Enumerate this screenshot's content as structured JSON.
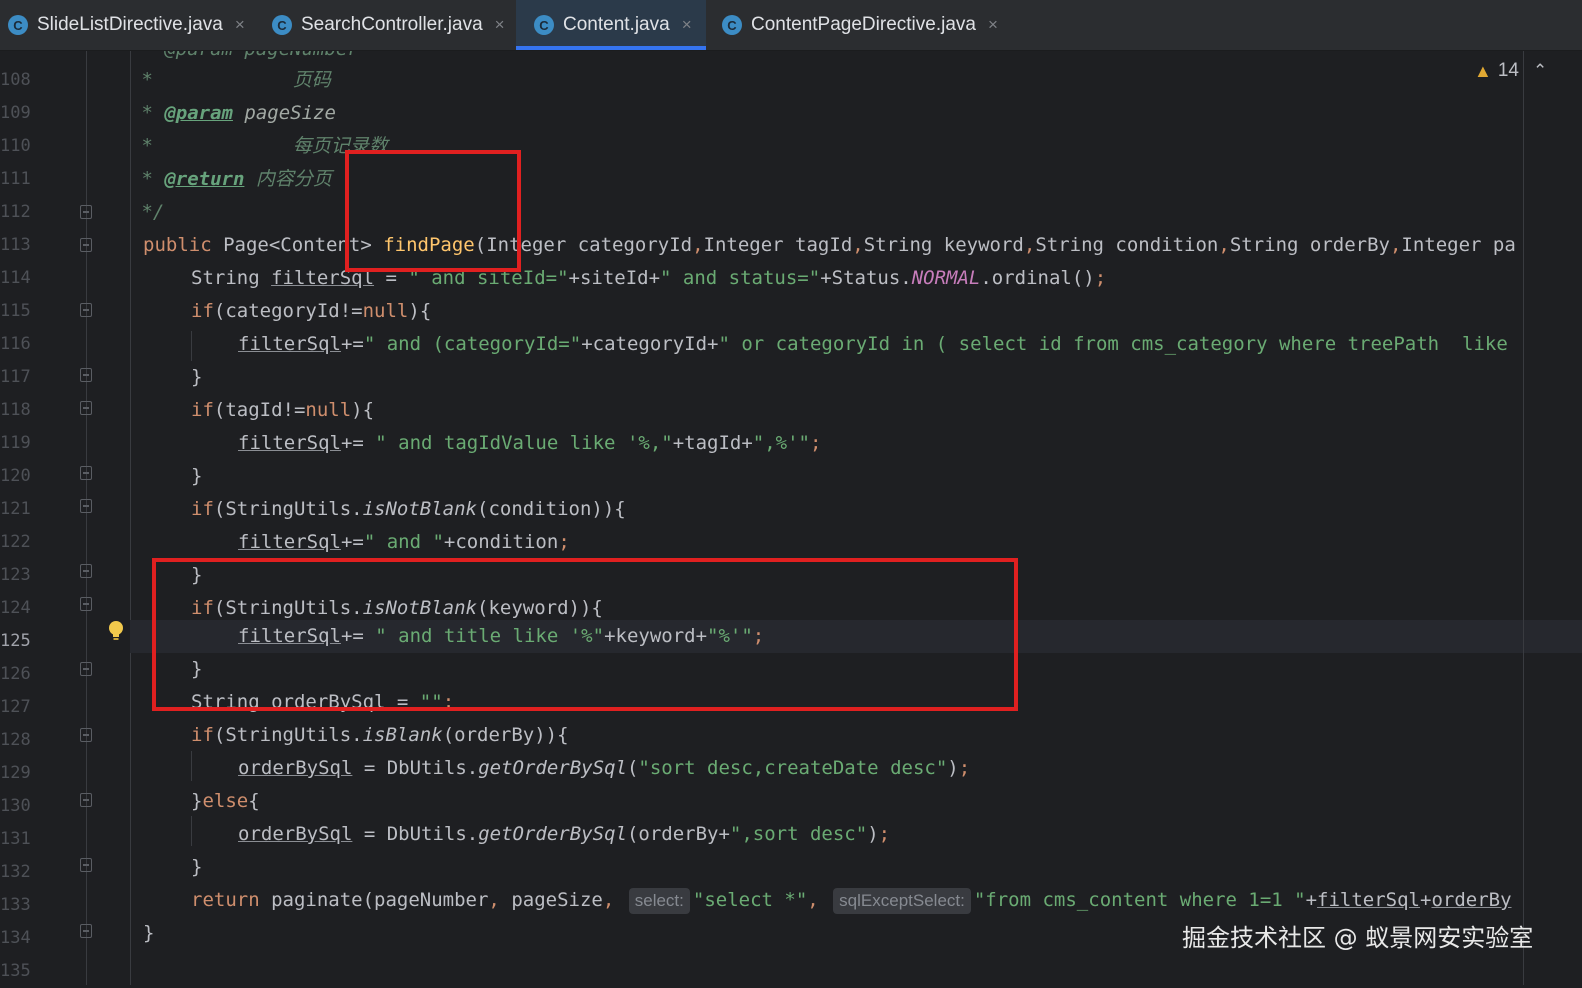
{
  "tabs": [
    {
      "icon": "C",
      "label": "SlideListDirective.java",
      "close": "×",
      "active": false
    },
    {
      "icon": "C",
      "label": "SearchController.java",
      "close": "×",
      "active": false
    },
    {
      "icon": "C",
      "label": "Content.java",
      "close": "×",
      "active": true
    },
    {
      "icon": "C",
      "label": "ContentPageDirective.java",
      "close": "×",
      "active": false
    }
  ],
  "inspections": {
    "count": "14",
    "icon": "warning-icon"
  },
  "line_numbers": [
    "108",
    "109",
    "110",
    "111",
    "112",
    "113",
    "114",
    "115",
    "116",
    "117",
    "118",
    "119",
    "120",
    "121",
    "122",
    "123",
    "124",
    "125",
    "126",
    "127",
    "128",
    "129",
    "130",
    "131",
    "132",
    "133",
    "134",
    "135"
  ],
  "current_line": "125",
  "code": {
    "l107": " * @param pageNumber",
    "l108_a": " *",
    "l108_b": "页码",
    "l109_a": " * ",
    "l109_tag": "@param",
    "l109_b": " pageSize",
    "l110_a": " *",
    "l110_b": "每页记录数",
    "l111_a": " * ",
    "l111_tag": "@return",
    "l111_b": " 内容分页",
    "l112": " */",
    "l113_kw": "public",
    "l113_a": " Page<Content> ",
    "l113_fn": "findPage",
    "l113_b": "(Integer categoryId",
    "l113_c": ",",
    "l113_d": "Integer tagId",
    "l113_e": ",",
    "l113_f": "String keyword",
    "l113_g": ",",
    "l113_h": "String condition",
    "l113_i": ",",
    "l113_j": "String orderBy",
    "l113_k": ",",
    "l113_l": "Integer pa",
    "l114_a": "String ",
    "l114_var": "filterSql",
    "l114_b": " = ",
    "l114_s1": "\" and siteId=\"",
    "l114_c": "+siteId+",
    "l114_s2": "\" and status=\"",
    "l114_d": "+Status.",
    "l114_const": "NORMAL",
    "l114_e": ".ordinal()",
    "l114_semi": ";",
    "l115_kw": "if",
    "l115_a": "(categoryId!=",
    "l115_null": "null",
    "l115_b": "){",
    "l116_var": "filterSql",
    "l116_a": "+=",
    "l116_s1": "\" and (categoryId=\"",
    "l116_b": "+categoryId+",
    "l116_s2": "\" or categoryId in ( select id from cms_category where treePath  like",
    "l117": "}",
    "l118_kw": "if",
    "l118_a": "(tagId!=",
    "l118_null": "null",
    "l118_b": "){",
    "l119_var": "filterSql",
    "l119_a": "+= ",
    "l119_s1": "\" and tagIdValue like '%,\"",
    "l119_b": "+tagId+",
    "l119_s2": "\",%'\"",
    "l119_semi": ";",
    "l120": "}",
    "l121_kw": "if",
    "l121_a": "(StringUtils.",
    "l121_st": "isNotBlank",
    "l121_b": "(condition)){",
    "l122_var": "filterSql",
    "l122_a": "+=",
    "l122_s1": "\" and \"",
    "l122_b": "+condition",
    "l122_semi": ";",
    "l123": "}",
    "l124_kw": "if",
    "l124_a": "(StringUtils.",
    "l124_st": "isNotBlank",
    "l124_b": "(keyword)){",
    "l125_var": "filterSql",
    "l125_a": "+= ",
    "l125_s1": "\" and title like '%\"",
    "l125_b": "+keyword+",
    "l125_s2": "\"%'\"",
    "l125_semi": ";",
    "l126": "}",
    "l127_a": "String ",
    "l127_var": "orderBySql",
    "l127_b": " = ",
    "l127_s1": "\"\"",
    "l127_semi": ";",
    "l128_kw": "if",
    "l128_a": "(StringUtils.",
    "l128_st": "isBlank",
    "l128_b": "(orderBy)){",
    "l129_var": "orderBySql",
    "l129_a": " = DbUtils.",
    "l129_st": "getOrderBySql",
    "l129_b": "(",
    "l129_s1": "\"sort desc,createDate desc\"",
    "l129_c": ")",
    "l129_semi": ";",
    "l130_a": "}",
    "l130_kw": "else",
    "l130_b": "{",
    "l131_var": "orderBySql",
    "l131_a": " = DbUtils.",
    "l131_st": "getOrderBySql",
    "l131_b": "(orderBy+",
    "l131_s1": "\",sort desc\"",
    "l131_c": ")",
    "l131_semi": ";",
    "l132": "}",
    "l133_kw": "return",
    "l133_a": " paginate(pageNumber",
    "l133_c1": ",",
    "l133_b": " pageSize",
    "l133_c2": ",",
    "l133_hint1": "select:",
    "l133_s1": "\"select *\"",
    "l133_c3": ",",
    "l133_hint2": "sqlExceptSelect:",
    "l133_s2": "\"from cms_content where 1=1 \"",
    "l133_d": "+",
    "l133_var1": "filterSql",
    "l133_e": "+",
    "l133_var2": "orderBy",
    "l134": "}"
  },
  "watermark": "掘金技术社区 @ 蚁景网安实验室",
  "colors": {
    "keyword": "#cf8e6d",
    "string": "#6aab73",
    "method": "#ffc66d",
    "highlight": "#e02020",
    "tab_active": "#3574f0"
  }
}
